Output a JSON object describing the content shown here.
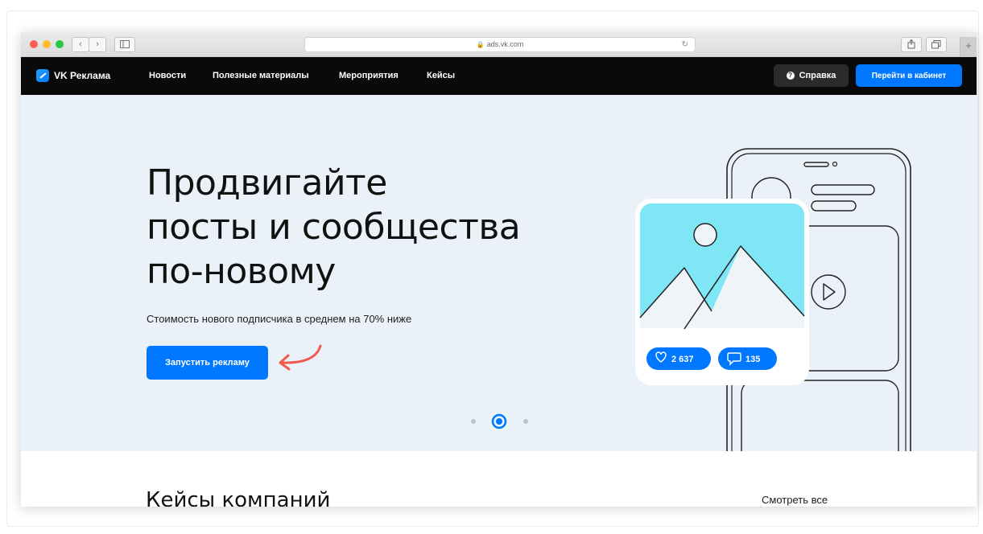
{
  "browser": {
    "url": "ads.vk.com",
    "back_icon": "chevron-left-icon",
    "forward_icon": "chevron-right-icon",
    "sidebar_icon": "sidebar-icon",
    "share_icon": "share-icon",
    "tabs_icon": "tabs-icon",
    "new_tab_label": "+"
  },
  "nav": {
    "logo_text": "VK Реклама",
    "items": [
      "Новости",
      "Полезные материалы",
      "Мероприятия",
      "Кейсы"
    ],
    "help_label": "Справка",
    "cabinet_label": "Перейти в кабинет"
  },
  "hero": {
    "title_line1": "Продвигайте",
    "title_line2": "посты и сообщества",
    "title_line3": "по-новому",
    "subtitle": "Стоимость нового подписчика в среднем на 70% ниже",
    "cta_label": "Запустить рекламу",
    "likes": "2 637",
    "comments": "135",
    "active_slide": 2,
    "slide_count": 3
  },
  "cases": {
    "title": "Кейсы компаний",
    "see_all": "Смотреть все"
  },
  "colors": {
    "accent": "#0077ff",
    "nav_bg": "#0a0a0a",
    "hero_bg": "#eaf1f8",
    "image_sky": "#7fe6f6",
    "arrow": "#f05a4f"
  }
}
